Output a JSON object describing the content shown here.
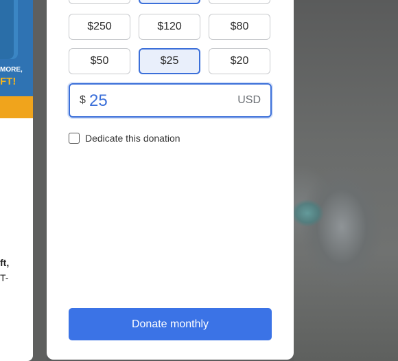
{
  "left_panel": {
    "promo_more": "MORE,",
    "promo_gift": "FT!",
    "text_line1": "ft,",
    "text_line2": "T-"
  },
  "amounts": {
    "row1": [
      "$250",
      "$120",
      "$80"
    ],
    "row2": [
      "$50",
      "$25",
      "$20"
    ],
    "selected": "$25"
  },
  "custom_amount": {
    "currency_sign": "$",
    "value": "25",
    "currency_code": "USD"
  },
  "dedicate": {
    "label": "Dedicate this donation",
    "checked": false
  },
  "donate_button": {
    "label": "Donate monthly"
  },
  "colors": {
    "accent": "#3b73e6",
    "selected_bg": "#e9effb"
  }
}
